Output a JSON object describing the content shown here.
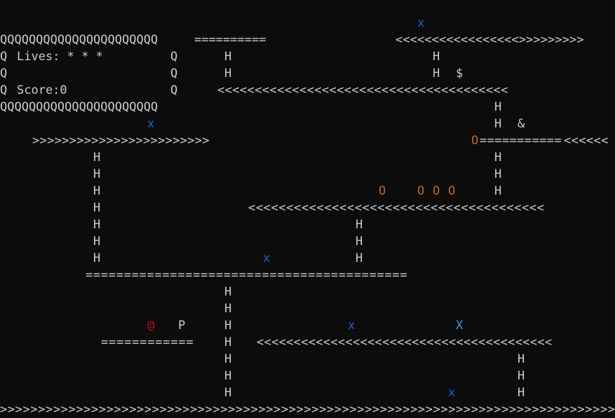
{
  "colors": {
    "background": "#0c0c0c",
    "text": "#cccccc",
    "enemy_x": "#1f5fd8",
    "barrel_o": "#c0672a",
    "player_at": "#c50f1f",
    "enemy_big_x": "#3a96dd"
  },
  "hud": {
    "border_row": "QQQQQQQQQQQQQQQQQQQQQQ",
    "side_char": "Q",
    "lives_text": "Lives: * * *",
    "score_text": "Score:0"
  },
  "platforms": [
    {
      "id": "plat-top-left",
      "text": "=========="
    },
    {
      "id": "plat-top-right",
      "text": "<<<<<<<<<<<<<<<<<>>>>>>>>>"
    },
    {
      "id": "plat-row4",
      "text": "<<<<<<<<<<<<<<<<<<<<<<<<<<<<<<<<<<<<<<<"
    },
    {
      "id": "plat-row7-left",
      "text": ">>>>>>>>>>>>>>>>>>>>>>>>"
    },
    {
      "id": "plat-row7-right-eq",
      "text": "==========="
    },
    {
      "id": "plat-row7-right-lt",
      "text": "<<<<<<"
    },
    {
      "id": "plat-row11",
      "text": "<<<<<<<<<<<<<<<<<<<<<<<<<<<<<<<<<<<<<<<"
    },
    {
      "id": "plat-row15",
      "text": "=========================================="
    },
    {
      "id": "plat-row19-left",
      "text": "============"
    },
    {
      "id": "plat-row19-right",
      "text": "<<<<<<<<<<<<<<<<<<<<<<<<<<<<<<<<<<<<<<<<"
    },
    {
      "id": "plat-bottom",
      "text": ">>>>>>>>>>>>>>>>>>>>>>>>>>>>>>>>>>>>>>>>>>>>>>>>>>>>>>>>>>>>>>>>>>>>>>>>>>>>>>>>>"
    }
  ],
  "ladder_char": "H",
  "items": {
    "dollar": "$",
    "ampersand": "&",
    "player": "@",
    "princess": "P",
    "barrel": "O",
    "enemy": "x",
    "enemy_big": "X"
  }
}
